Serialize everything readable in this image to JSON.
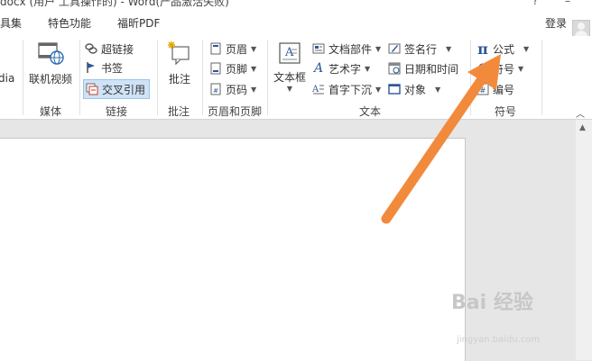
{
  "titlebar": {
    "title": "docx (用户 工具操作的) - Word(产品激活失败)",
    "help": "?",
    "minimize": "–"
  },
  "tabs": [
    {
      "label": "具集"
    },
    {
      "label": "特色功能"
    },
    {
      "label": "福昕PDF"
    }
  ],
  "account": {
    "login": "登录"
  },
  "ribbon": {
    "media": {
      "label": "媒体",
      "cut_text": "dia",
      "online_video": "联机视频"
    },
    "links": {
      "label": "链接",
      "hyperlink": "超链接",
      "bookmark": "书签",
      "cross_reference": "交叉引用"
    },
    "comments": {
      "label": "批注",
      "comment": "批注"
    },
    "header_footer": {
      "label": "页眉和页脚",
      "header": "页眉",
      "footer": "页脚",
      "page_number": "页码"
    },
    "text": {
      "label": "文本",
      "textbox": "文本框",
      "quick_parts": "文档部件",
      "wordart": "艺术字",
      "dropcap": "首字下沉",
      "signature": "签名行",
      "datetime": "日期和时间",
      "object": "对象"
    },
    "symbols": {
      "label": "符号",
      "equation": "公式",
      "symbol": "符号",
      "number": "编号"
    }
  },
  "annotation": {
    "arrow_color": "#f28a3c"
  },
  "watermark": {
    "brand": "Bai 经验",
    "url": "jingyan.baidu.com"
  },
  "colors": {
    "accent": "#2b579a",
    "selection": "#cfe3f7"
  }
}
